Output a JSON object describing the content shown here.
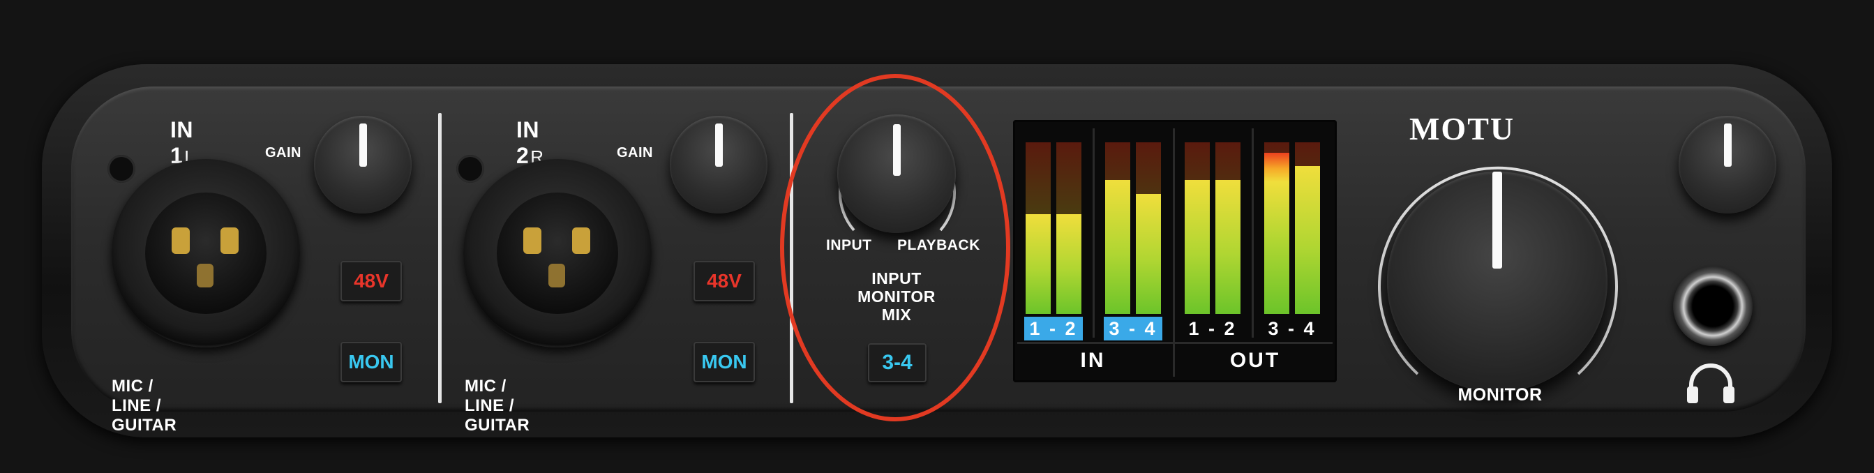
{
  "device": {
    "brand": "MOTU"
  },
  "input1": {
    "title_main": "IN 1",
    "title_side": "L",
    "gain_label": "GAIN",
    "phantom_label": "48V",
    "mon_label": "MON",
    "jack_label": "MIC / LINE / GUITAR"
  },
  "input2": {
    "title_main": "IN 2",
    "title_side": "R",
    "gain_label": "GAIN",
    "phantom_label": "48V",
    "mon_label": "MON",
    "jack_label": "MIC / LINE / GUITAR"
  },
  "monitor_mix": {
    "left_label": "INPUT",
    "right_label": "PLAYBACK",
    "title_line1": "INPUT",
    "title_line2": "MONITOR",
    "title_line3": "MIX",
    "button_label": "3-4"
  },
  "meters": {
    "in_label": "IN",
    "out_label": "OUT",
    "channels": [
      {
        "label": "1 - 2",
        "active": true,
        "levels": [
          0.58,
          0.58
        ]
      },
      {
        "label": "3 - 4",
        "active": true,
        "levels": [
          0.78,
          0.7
        ]
      },
      {
        "label": "1 - 2",
        "active": false,
        "levels": [
          0.78,
          0.78
        ]
      },
      {
        "label": "3 - 4",
        "active": false,
        "levels": [
          0.94,
          0.86
        ]
      }
    ]
  },
  "main": {
    "monitor_label": "MONITOR"
  },
  "colors": {
    "accent_red": "#e8352a",
    "accent_cyan": "#39c8f0",
    "active_channel": "#3aa9e8",
    "highlight": "#e23a22"
  },
  "icons": {
    "headphones": "headphones-icon"
  }
}
